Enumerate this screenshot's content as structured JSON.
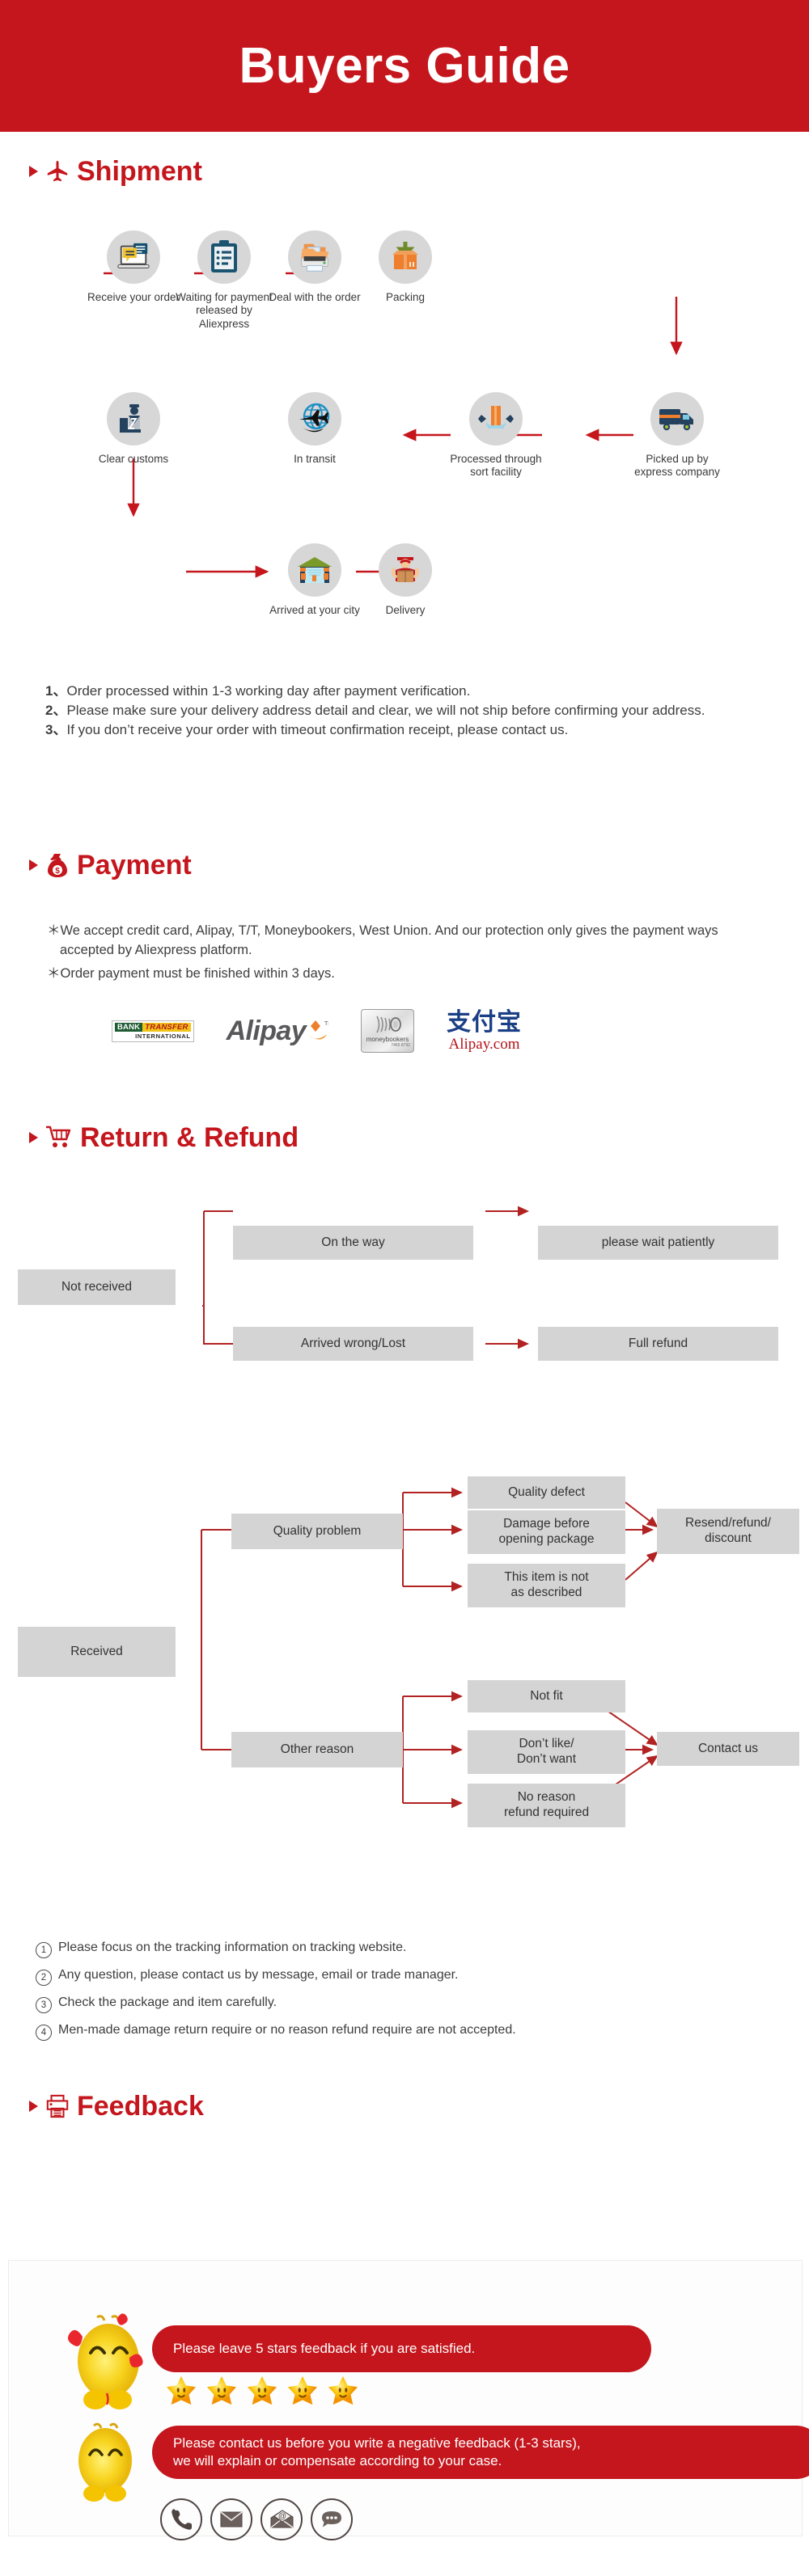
{
  "page": {
    "title": "Buyers Guide",
    "accent": "#c4161c",
    "box_gray": "#d4d4d4",
    "bubble_gray": "#d7d7d7"
  },
  "sections": {
    "shipment": {
      "label": "Shipment",
      "icon": "airplane-icon"
    },
    "payment": {
      "label": "Payment",
      "icon": "money-bag-icon"
    },
    "return": {
      "label": "Return & Refund",
      "icon": "shopping-cart-icon"
    },
    "feedback": {
      "label": "Feedback",
      "icon": "printer-icon"
    }
  },
  "shipment": {
    "steps": [
      {
        "id": "receive-order",
        "label": "Receive your order",
        "icon": "laptop-chat-icon"
      },
      {
        "id": "waiting-payment",
        "label": "Waiting for payment\nreleased by Aliexpress",
        "icon": "clipboard-icon"
      },
      {
        "id": "deal-order",
        "label": "Deal with the order",
        "icon": "printer-folder-icon"
      },
      {
        "id": "packing",
        "label": "Packing",
        "icon": "open-box-icon"
      },
      {
        "id": "picked-up",
        "label": "Picked up by\nexpress company",
        "icon": "delivery-truck-icon"
      },
      {
        "id": "sort-facility",
        "label": "Processed through\nsort facility",
        "icon": "sorting-icon"
      },
      {
        "id": "in-transit",
        "label": "In transit",
        "icon": "globe-plane-icon"
      },
      {
        "id": "clear-customs",
        "label": "Clear customs",
        "icon": "customs-officer-icon"
      },
      {
        "id": "arrived-city",
        "label": "Arrived at your city",
        "icon": "warehouse-icon"
      },
      {
        "id": "delivery",
        "label": "Delivery",
        "icon": "courier-icon"
      }
    ],
    "notes": [
      {
        "num": "1、",
        "text": "Order processed within 1-3 working day after payment verification."
      },
      {
        "num": "2、",
        "text": "Please make sure your delivery address detail and clear, we will not ship before confirming your address."
      },
      {
        "num": "3、",
        "text": "If you don’t receive your order with timeout confirmation receipt, please contact us."
      }
    ]
  },
  "payment": {
    "bullets": [
      "＊We accept credit card, Alipay, T/T, Moneybookers, West Union. And our protection only gives the payment ways accepted by Aliexpress platform.",
      "＊Order payment must be finished within 3 days."
    ],
    "logos": [
      {
        "id": "bank-transfer-logo",
        "name": "bank-transfer-logo",
        "line1": "BANK",
        "line2": "TRANSFER",
        "line3": "INTERNATIONAL"
      },
      {
        "id": "alipay-logo",
        "name": "alipay-logo",
        "text": "Alipay"
      },
      {
        "id": "moneybookers-logo",
        "name": "moneybookers-logo",
        "text": "moneybookers",
        "code": "7465 8792"
      },
      {
        "id": "alipay-cn-logo",
        "name": "alipay-cn-logo",
        "cn": "支付宝",
        "en": "Alipay.com"
      }
    ]
  },
  "return_refund": {
    "not_received": {
      "root": "Not received",
      "branches": [
        {
          "cause": "On the way",
          "result": "please wait patiently"
        },
        {
          "cause": "Arrived wrong/Lost",
          "result": "Full refund"
        }
      ]
    },
    "received": {
      "root": "Received",
      "groups": [
        {
          "cause": "Quality problem",
          "reasons": [
            "Quality defect",
            "Damage before\nopening package",
            "This item is not\nas described"
          ],
          "result": "Resend/refund/\ndiscount"
        },
        {
          "cause": "Other reason",
          "reasons": [
            "Not fit",
            "Don’t like/\nDon’t want",
            "No reason\nrefund required"
          ],
          "result": "Contact us"
        }
      ]
    },
    "notes": [
      {
        "num": "1",
        "text": "Please focus on the tracking information on tracking website."
      },
      {
        "num": "2",
        "text": "Any question, please contact us by message, email or trade manager."
      },
      {
        "num": "3",
        "text": "Check the package and item carefully."
      },
      {
        "num": "4",
        "text": "Men-made damage return require or no reason refund require are not accepted."
      }
    ]
  },
  "feedback": {
    "positive_message": "Please leave 5 stars feedback if you are satisfied.",
    "negative_message": "Please contact us before you write a negative feedback (1-3 stars),\nwe will explain or compensate according to your case.",
    "star_count": 5,
    "contact_icons": [
      {
        "id": "phone",
        "name": "phone-icon"
      },
      {
        "id": "mail",
        "name": "envelope-icon"
      },
      {
        "id": "email",
        "name": "email-at-icon"
      },
      {
        "id": "chat",
        "name": "chat-bubble-icon"
      }
    ]
  }
}
